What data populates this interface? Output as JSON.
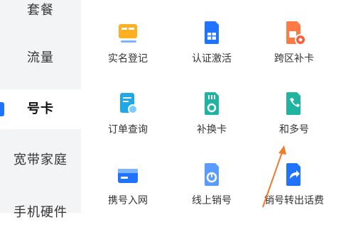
{
  "sidebar": {
    "items": [
      {
        "label": "套餐"
      },
      {
        "label": "流量"
      },
      {
        "label": "号卡"
      },
      {
        "label": "宽带家庭"
      },
      {
        "label": "手机硬件"
      }
    ]
  },
  "grid": {
    "tiles": [
      {
        "label": "实名登记",
        "icon": "id-card-icon"
      },
      {
        "label": "认证激活",
        "icon": "sim-card-icon"
      },
      {
        "label": "跨区补卡",
        "icon": "sim-card-icon"
      },
      {
        "label": "订单查询",
        "icon": "order-search-icon"
      },
      {
        "label": "补换卡",
        "icon": "sim-card-icon"
      },
      {
        "label": "和多号",
        "icon": "phone-icon"
      },
      {
        "label": "携号入网",
        "icon": "card-icon"
      },
      {
        "label": "线上销号",
        "icon": "sim-card-icon"
      },
      {
        "label": "销号转出话费",
        "icon": "transfer-icon"
      }
    ]
  },
  "colors": {
    "accent": "#1f73ff",
    "secondary": "#ff8a3d",
    "annotation_arrow": "#f07a2a"
  }
}
